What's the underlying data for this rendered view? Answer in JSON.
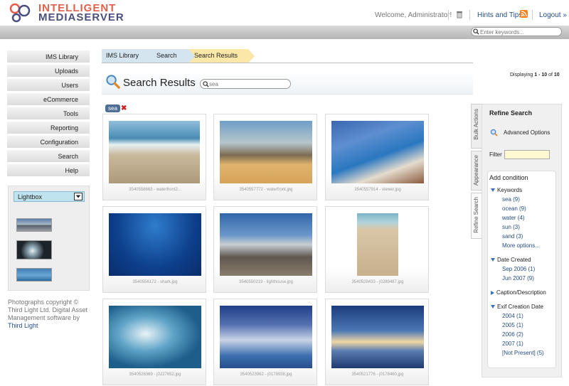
{
  "header": {
    "logo_line1": "INTELLIGENT",
    "logo_line2": "MEDIASERVER",
    "welcome": "Welcome, Administrator!",
    "hints": "Hints and Tips",
    "logout": "Logout »",
    "search_placeholder": "Enter keywords...",
    "accent": "#e0604d",
    "brand": "#4b4f7d",
    "link_color": "#254d85",
    "icons": [
      "trash-icon",
      "rss-icon",
      "search-icon"
    ]
  },
  "menu": {
    "items": [
      {
        "label": "IMS Library"
      },
      {
        "label": "Uploads"
      },
      {
        "label": "Users"
      },
      {
        "label": "eCommerce"
      },
      {
        "label": "Tools"
      },
      {
        "label": "Reporting"
      },
      {
        "label": "Configuration"
      },
      {
        "label": "Search"
      },
      {
        "label": "Help"
      }
    ]
  },
  "lightbox": {
    "selected": "Lightbox"
  },
  "footer": {
    "copyright": "Photographs copyright © Third Light Ltd. Digital Asset Management software by",
    "link": "Third Light"
  },
  "breadcrumb": {
    "items": [
      "IMS Library",
      "Search",
      "Search Results"
    ]
  },
  "main": {
    "title": "Search Results",
    "search_value": "sea",
    "display_prefix": "Displaying",
    "display_range": "1 - 10",
    "display_of": "of",
    "display_total": "10",
    "tag": "sea",
    "tag_remove": "✖"
  },
  "results": [
    {
      "caption": "3540558663 - waterfront2..."
    },
    {
      "caption": "3540557772 - waterfront.jpg"
    },
    {
      "caption": "3540557914 - viewer.jpg"
    },
    {
      "caption": "3540556172 - shark.jpg"
    },
    {
      "caption": "3540550219 - lighthouse.jpg"
    },
    {
      "caption": "3540528433 - j0289487.jpg"
    },
    {
      "caption": "3540526369 - j0227652.jpg"
    },
    {
      "caption": "3540523962 - j0178938.jpg"
    },
    {
      "caption": "3540521776 - j0178460.jpg"
    }
  ],
  "sidetabs": [
    "Bulk Actions",
    "Appearance",
    "Refine Search"
  ],
  "refine": {
    "title": "Refine Search",
    "advanced": "Advanced Options",
    "filter_label": "Filter",
    "add_condition": "Add condition",
    "keywords_head": "Keywords",
    "keywords": [
      "sea (9)",
      "ocean (9)",
      "water (4)",
      "sun (3)",
      "sand (3)",
      "More options..."
    ],
    "date_head": "Date Created",
    "dates": [
      "Sep 2006 (1)",
      "Jun 2007 (9)"
    ],
    "caption_head": "Caption/Description",
    "exif_head": "Exif Creation Date",
    "exif": [
      "2004 (1)",
      "2005 (1)",
      "2006 (2)",
      "2007 (1)",
      "[Not Present] (5)"
    ]
  }
}
